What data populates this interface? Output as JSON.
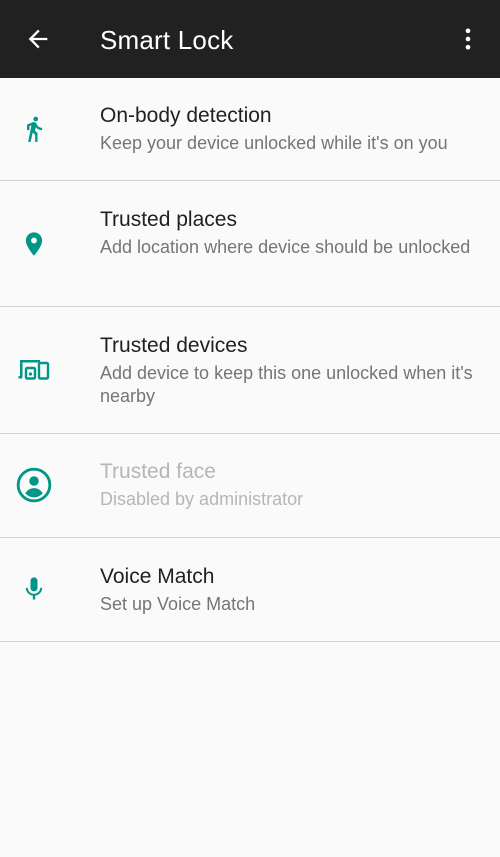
{
  "app_bar": {
    "title": "Smart Lock",
    "back_icon": "arrow-back-icon",
    "overflow_icon": "more-vert-icon",
    "background": "#212121"
  },
  "accent_color": "#009688",
  "items": [
    {
      "title": "On-body detection",
      "subtitle": "Keep your device unlocked while it's on you",
      "icon": "walking-person-icon",
      "enabled": true
    },
    {
      "title": "Trusted places",
      "subtitle": "Add location where device should be unlocked",
      "icon": "location-pin-icon",
      "enabled": true
    },
    {
      "title": "Trusted devices",
      "subtitle": "Add device to keep this one unlocked when it's nearby",
      "icon": "devices-icon",
      "enabled": true
    },
    {
      "title": "Trusted face",
      "subtitle": "Disabled by administrator",
      "icon": "face-icon",
      "enabled": false
    },
    {
      "title": "Voice Match",
      "subtitle": "Set up Voice Match",
      "icon": "microphone-icon",
      "enabled": true
    }
  ]
}
